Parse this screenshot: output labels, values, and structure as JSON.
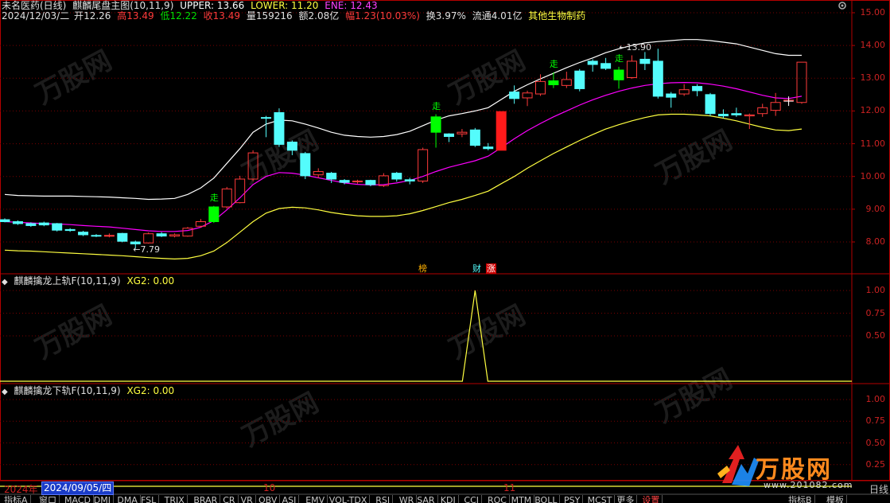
{
  "header": {
    "stock": "未名医药(日线)",
    "indicator": "麒麟尾盘主图(10,11,9)",
    "upper": "UPPER: 13.66",
    "lower": "LOWER: 11.20",
    "ene": "ENE: 12.43",
    "date": "2024/12/03/二",
    "open_lbl": "开",
    "open": "12.26",
    "high_lbl": "高",
    "high": "13.49",
    "low_lbl": "低",
    "low": "12.22",
    "close_lbl": "收",
    "close": "13.49",
    "vol_lbl": "量",
    "vol": "159216",
    "amt_lbl": "额",
    "amt": "2.08亿",
    "chg_lbl": "幅",
    "chg": "1.23(10.03%)",
    "turn": "换3.97%",
    "float": "流通4.01亿",
    "sector": "其他生物制药"
  },
  "sub1": {
    "title": "麒麟擒龙上轨F(10,11,9)",
    "xg2": "XG2: 0.00"
  },
  "sub2": {
    "title": "麒麟擒龙下轨F(10,11,9)",
    "xg2": "XG2: 0.00"
  },
  "price_ticks": [
    "15.00",
    "14.00",
    "13.00",
    "12.00",
    "11.00",
    "10.00",
    "9.00",
    "8.00"
  ],
  "sub1_ticks": [
    "1.00",
    "0.75",
    "0.50"
  ],
  "sub2_ticks": [
    "1.00",
    "0.75",
    "0.50",
    "0.25"
  ],
  "annotations": {
    "low_mark": "7.79",
    "high_mark": "13.90",
    "walk": "走",
    "bang": "榜",
    "cai": "财",
    "zhang": "涨"
  },
  "xaxis": {
    "year": "2024年",
    "date": "2024/09/05/四",
    "m10": "10",
    "m11": "11",
    "right": "日线"
  },
  "tabs": [
    "指标A",
    "窗口",
    "MACD",
    "DMI",
    "DMA",
    "FSL",
    "TRIX",
    "BRAR",
    "CR",
    "VR",
    "OBV",
    "ASI",
    "EMV",
    "VOL-TDX",
    "RSI",
    "WR",
    "SAR",
    "KDJ",
    "CCI",
    "ROC",
    "MTM",
    "BOLL",
    "PSY",
    "MCST",
    "更多",
    "设置"
  ],
  "tabs_right": [
    "指标B",
    "模板"
  ],
  "logo": {
    "text": "万股网",
    "url": "www.201082.com"
  },
  "watermark": "万股网",
  "colors": {
    "up": "#ff3b3b",
    "down": "#54fcfc",
    "bigup": "#ff1a1a",
    "signal": "#00ff00",
    "upper": "#ffffff",
    "mid": "#ff00ff",
    "lower": "#ffff40",
    "grid": "#7a0000",
    "axis": "#b40000"
  },
  "chart_data": {
    "type": "candlestick",
    "candles": [
      [
        8.68,
        8.62,
        8.72,
        8.6
      ],
      [
        8.62,
        8.56,
        8.66,
        8.52
      ],
      [
        8.56,
        8.5,
        8.6,
        8.46
      ],
      [
        8.58,
        8.52,
        8.62,
        8.48
      ],
      [
        8.56,
        8.36,
        8.58,
        8.32
      ],
      [
        8.38,
        8.35,
        8.42,
        8.31
      ],
      [
        8.3,
        8.22,
        8.34,
        8.18
      ],
      [
        8.2,
        8.19,
        8.24,
        8.15
      ],
      [
        8.18,
        8.2,
        8.26,
        8.14
      ],
      [
        8.26,
        8.02,
        8.28,
        7.99
      ],
      [
        8.0,
        7.94,
        8.04,
        7.79
      ],
      [
        7.97,
        8.25,
        8.29,
        7.95
      ],
      [
        8.25,
        8.18,
        8.3,
        8.15
      ],
      [
        8.18,
        8.22,
        8.26,
        8.14
      ],
      [
        8.18,
        8.42,
        8.46,
        8.16
      ],
      [
        8.48,
        8.62,
        8.7,
        8.44
      ],
      [
        8.62,
        9.07,
        9.1,
        8.58
      ],
      [
        9.07,
        9.62,
        9.68,
        9.02
      ],
      [
        9.2,
        9.92,
        10.02,
        9.18
      ],
      [
        9.92,
        10.72,
        10.8,
        9.86
      ],
      [
        11.8,
        11.78,
        11.85,
        11.2
      ],
      [
        11.95,
        10.98,
        12.08,
        10.9
      ],
      [
        11.05,
        10.8,
        11.1,
        10.65
      ],
      [
        10.7,
        10.02,
        10.75,
        9.92
      ],
      [
        10.05,
        10.15,
        10.25,
        9.95
      ],
      [
        10.1,
        9.92,
        10.14,
        9.8
      ],
      [
        9.88,
        9.82,
        9.92,
        9.76
      ],
      [
        9.84,
        9.86,
        9.9,
        9.78
      ],
      [
        9.88,
        9.75,
        9.9,
        9.7
      ],
      [
        9.72,
        10.02,
        10.1,
        9.68
      ],
      [
        10.1,
        9.92,
        10.14,
        9.84
      ],
      [
        9.9,
        9.86,
        9.96,
        9.76
      ],
      [
        9.86,
        10.82,
        10.88,
        9.8
      ],
      [
        11.35,
        11.82,
        11.9,
        10.88
      ],
      [
        11.3,
        11.22,
        11.32,
        11.05
      ],
      [
        11.3,
        11.35,
        11.45,
        11.2
      ],
      [
        11.42,
        10.95,
        11.48,
        10.9
      ],
      [
        10.9,
        10.85,
        11.02,
        10.8
      ],
      [
        10.8,
        11.98,
        11.98,
        10.8
      ],
      [
        12.58,
        12.38,
        12.78,
        12.22
      ],
      [
        12.4,
        12.55,
        12.62,
        12.15
      ],
      [
        12.52,
        12.9,
        13.12,
        12.46
      ],
      [
        12.8,
        12.92,
        13.18,
        12.7
      ],
      [
        12.78,
        12.96,
        13.2,
        12.7
      ],
      [
        13.22,
        12.68,
        13.28,
        12.6
      ],
      [
        13.52,
        13.42,
        13.58,
        13.2
      ],
      [
        13.45,
        13.3,
        13.62,
        13.25
      ],
      [
        13.25,
        12.95,
        13.35,
        12.68
      ],
      [
        13.02,
        13.52,
        13.7,
        12.98
      ],
      [
        13.58,
        13.45,
        13.8,
        13.25
      ],
      [
        13.52,
        12.45,
        13.9,
        12.38
      ],
      [
        12.52,
        12.42,
        12.58,
        12.1
      ],
      [
        12.52,
        12.65,
        12.82,
        12.46
      ],
      [
        12.75,
        12.62,
        12.82,
        12.45
      ],
      [
        12.5,
        11.92,
        12.55,
        11.85
      ],
      [
        11.9,
        11.85,
        12.05,
        11.78
      ],
      [
        11.92,
        11.88,
        12.1,
        11.82
      ],
      [
        11.85,
        11.88,
        11.92,
        11.45
      ],
      [
        11.92,
        12.1,
        12.22,
        11.82
      ],
      [
        12.02,
        12.26,
        12.55,
        11.85
      ],
      [
        12.3,
        12.33,
        12.38,
        12.22
      ],
      [
        12.26,
        13.49,
        13.49,
        12.22
      ]
    ],
    "upper_band": [
      9.45,
      9.42,
      9.41,
      9.4,
      9.4,
      9.4,
      9.39,
      9.38,
      9.37,
      9.35,
      9.33,
      9.3,
      9.31,
      9.33,
      9.45,
      9.65,
      9.95,
      10.4,
      10.85,
      11.35,
      11.6,
      11.72,
      11.7,
      11.6,
      11.48,
      11.35,
      11.26,
      11.22,
      11.2,
      11.22,
      11.28,
      11.38,
      11.55,
      11.72,
      11.85,
      11.92,
      12.0,
      12.1,
      12.35,
      12.6,
      12.8,
      12.98,
      13.15,
      13.32,
      13.48,
      13.62,
      13.78,
      13.9,
      14.0,
      14.08,
      14.12,
      14.15,
      14.18,
      14.18,
      14.15,
      14.1,
      14.05,
      13.95,
      13.85,
      13.75,
      13.7,
      13.7
    ],
    "mid_band": [
      8.62,
      8.6,
      8.58,
      8.56,
      8.55,
      8.53,
      8.5,
      8.48,
      8.46,
      8.42,
      8.38,
      8.34,
      8.32,
      8.32,
      8.35,
      8.45,
      8.65,
      8.98,
      9.35,
      9.75,
      10.0,
      10.12,
      10.1,
      10.04,
      9.96,
      9.88,
      9.8,
      9.76,
      9.74,
      9.75,
      9.8,
      9.88,
      10.0,
      10.15,
      10.28,
      10.38,
      10.48,
      10.62,
      10.88,
      11.15,
      11.4,
      11.62,
      11.82,
      12.0,
      12.18,
      12.34,
      12.48,
      12.6,
      12.7,
      12.78,
      12.83,
      12.86,
      12.87,
      12.86,
      12.82,
      12.76,
      12.68,
      12.58,
      12.48,
      12.4,
      12.38,
      12.45
    ],
    "lower_band": [
      7.75,
      7.73,
      7.72,
      7.7,
      7.68,
      7.66,
      7.64,
      7.62,
      7.6,
      7.58,
      7.55,
      7.52,
      7.5,
      7.48,
      7.5,
      7.58,
      7.72,
      7.98,
      8.3,
      8.62,
      8.88,
      9.02,
      9.06,
      9.04,
      8.98,
      8.9,
      8.84,
      8.8,
      8.78,
      8.78,
      8.8,
      8.86,
      8.96,
      9.08,
      9.2,
      9.3,
      9.42,
      9.55,
      9.78,
      10.0,
      10.25,
      10.48,
      10.7,
      10.9,
      11.1,
      11.28,
      11.45,
      11.58,
      11.7,
      11.8,
      11.88,
      11.9,
      11.9,
      11.88,
      11.85,
      11.78,
      11.7,
      11.6,
      11.5,
      11.42,
      11.4,
      11.45
    ],
    "xg2_spike_index": 36,
    "price_ylim": [
      7.4,
      15.2
    ]
  }
}
